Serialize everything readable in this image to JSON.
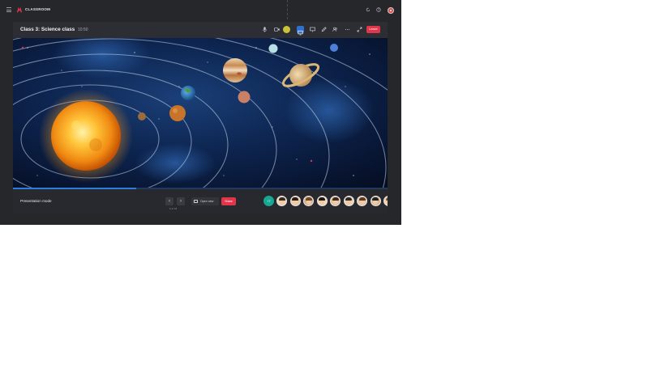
{
  "app": {
    "brand": "CLASSROOM",
    "logo_icon": "classroom-logo-icon",
    "top_icons": [
      "refresh-icon",
      "help-icon"
    ],
    "brand_color": "#e0354a"
  },
  "session": {
    "title": "Class 3: Science class",
    "time": "10:50",
    "toolbar": [
      "microphone-icon",
      "camera-icon",
      "reaction-icon",
      "share-screen-icon",
      "present-icon",
      "annotate-icon",
      "people-icon",
      "more-icon",
      "fullscreen-icon"
    ],
    "leave_label": "Leave",
    "slide_image": "solar-system-illustration",
    "progress": 0.33
  },
  "footer": {
    "mode_label": "Presentation mode",
    "slide_count": "6 of 18",
    "open_label": "Open new",
    "share_label": "Share",
    "participants_count": "+7",
    "participants": [
      {
        "name": "participant-1",
        "hair": "#3a2a1e",
        "bg": "#f0d4b3"
      },
      {
        "name": "participant-2",
        "hair": "#2a1c12",
        "bg": "#e9c8a5"
      },
      {
        "name": "participant-3",
        "hair": "#6b4a2b",
        "bg": "#d9b38c"
      },
      {
        "name": "participant-4",
        "hair": "#1f1610",
        "bg": "#f2d7b8"
      },
      {
        "name": "participant-5",
        "hair": "#3b2a20",
        "bg": "#e3c19c"
      },
      {
        "name": "participant-6",
        "hair": "#2b2b2b",
        "bg": "#efd2b0"
      },
      {
        "name": "participant-7",
        "hair": "#5a3a22",
        "bg": "#e8c6a2"
      },
      {
        "name": "participant-8",
        "hair": "#222222",
        "bg": "#dcb995"
      },
      {
        "name": "participant-9",
        "hair": "#7a5532",
        "bg": "#edd0ae"
      }
    ]
  }
}
